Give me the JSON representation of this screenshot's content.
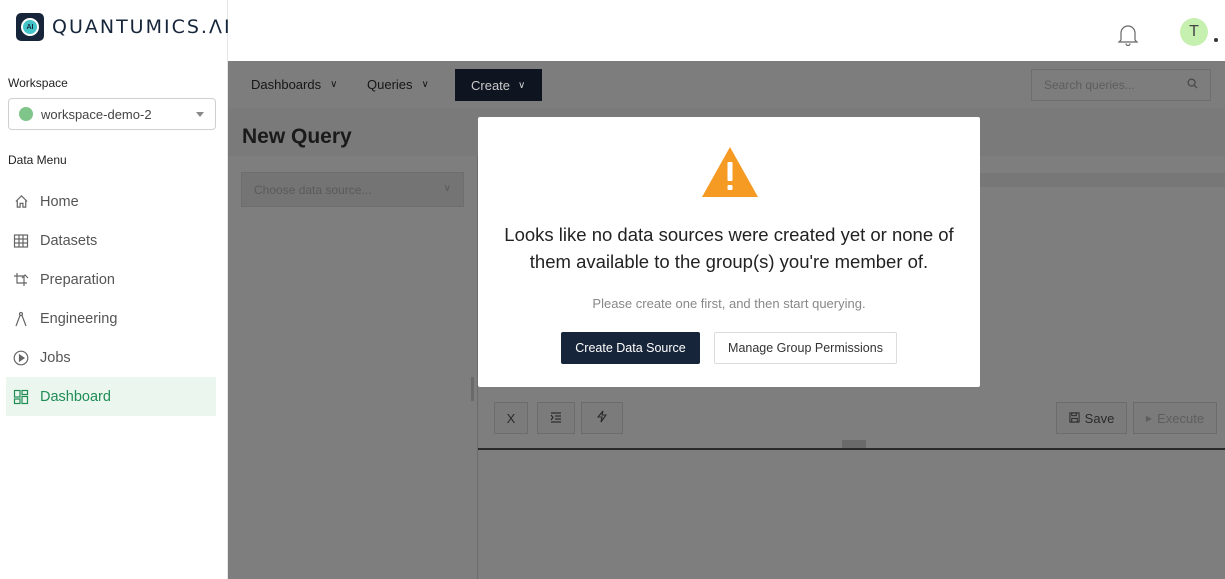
{
  "brand": {
    "name": "QUANTUMICS.ΛI",
    "logo_text": "AI"
  },
  "sidebar": {
    "workspace_label": "Workspace",
    "workspace_value": "workspace-demo-2",
    "data_menu_label": "Data Menu",
    "items": [
      {
        "label": "Home",
        "icon": "home-icon",
        "active": false
      },
      {
        "label": "Datasets",
        "icon": "grid-icon",
        "active": false
      },
      {
        "label": "Preparation",
        "icon": "crop-icon",
        "active": false
      },
      {
        "label": "Engineering",
        "icon": "compass-icon",
        "active": false
      },
      {
        "label": "Jobs",
        "icon": "play-circle-icon",
        "active": false
      },
      {
        "label": "Dashboard",
        "icon": "dashboard-icon",
        "active": true
      }
    ]
  },
  "header": {
    "avatar_letter": "T"
  },
  "toolbar": {
    "dashboards_label": "Dashboards",
    "queries_label": "Queries",
    "create_label": "Create",
    "search_placeholder": "Search queries..."
  },
  "page": {
    "title": "New Query",
    "datasource_placeholder": "Choose data source..."
  },
  "editor": {
    "btn_x": "X",
    "save_label": "Save",
    "execute_label": "Execute"
  },
  "modal": {
    "message": "Looks like no data sources were created yet or none of them available to the group(s) you're member of.",
    "sub_message": "Please create one first, and then start querying.",
    "primary_label": "Create Data Source",
    "secondary_label": "Manage Group Permissions"
  },
  "colors": {
    "accent": "#1f8d55",
    "navy": "#17253a",
    "warning": "#f59a23"
  }
}
